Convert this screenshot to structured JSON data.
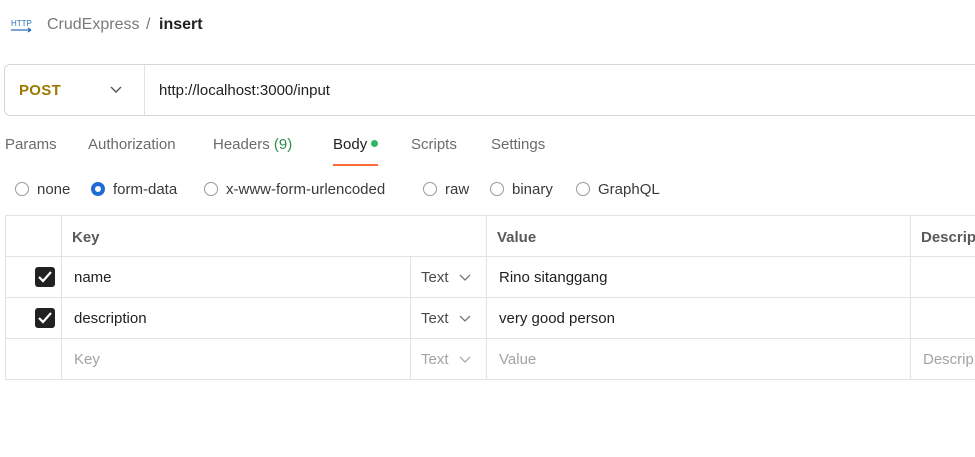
{
  "header": {
    "icon_text": "HTTP",
    "breadcrumb_parent": "CrudExpress",
    "breadcrumb_sep": "/",
    "breadcrumb_current": "insert"
  },
  "request": {
    "method": "POST",
    "url": "http://localhost:3000/input"
  },
  "tabs": [
    {
      "label": "Params"
    },
    {
      "label": "Authorization"
    },
    {
      "label": "Headers",
      "count": "(9)"
    },
    {
      "label": "Body",
      "active": true
    },
    {
      "label": "Scripts"
    },
    {
      "label": "Settings"
    }
  ],
  "body_types": [
    {
      "label": "none",
      "selected": false
    },
    {
      "label": "form-data",
      "selected": true
    },
    {
      "label": "x-www-form-urlencoded",
      "selected": false
    },
    {
      "label": "raw",
      "selected": false
    },
    {
      "label": "binary",
      "selected": false
    },
    {
      "label": "GraphQL",
      "selected": false
    }
  ],
  "table": {
    "headers": {
      "key": "Key",
      "value": "Value",
      "description": "Descrip"
    },
    "rows": [
      {
        "checked": true,
        "key": "name",
        "type": "Text",
        "value": "Rino sitanggang"
      },
      {
        "checked": true,
        "key": "description",
        "type": "Text",
        "value": "very good person"
      }
    ],
    "empty_row": {
      "key_placeholder": "Key",
      "type": "Text",
      "value_placeholder": "Value",
      "description_placeholder": "Descrip"
    }
  },
  "colors": {
    "method": "#9b7a00",
    "tab_active_underline": "#ff6c37",
    "body_dot": "#2fb761",
    "headers_count": "#2d8c4e",
    "radio_selected": "#1f6bd6"
  }
}
